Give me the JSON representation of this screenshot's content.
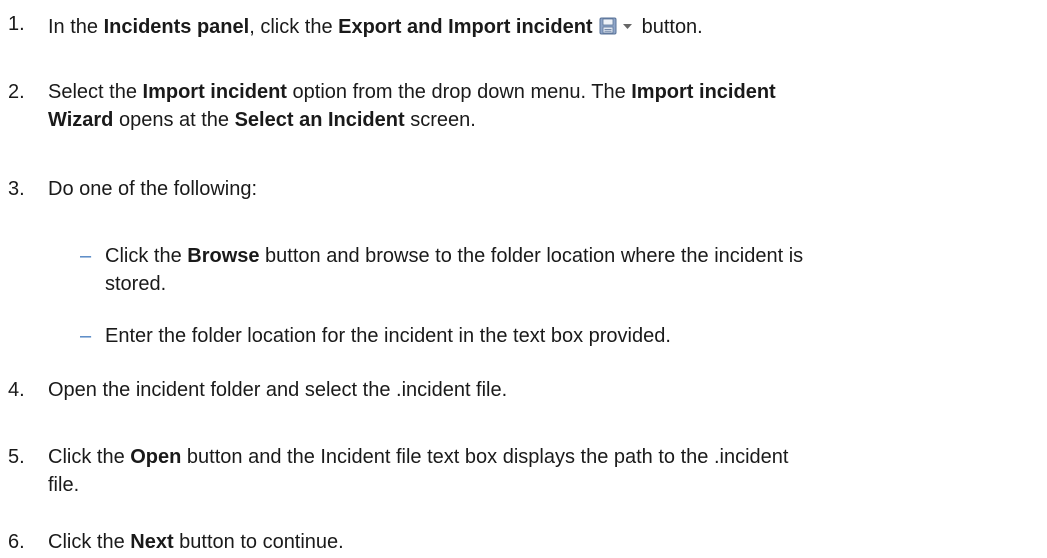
{
  "steps": [
    {
      "num": "1.",
      "p1": "In the ",
      "b1": "Incidents panel",
      "p2": ", click the ",
      "b2": "Export and Import incident",
      "icon": "save-icon",
      "p3": "button."
    },
    {
      "num": "2.",
      "p1": "Select the ",
      "b1": "Import incident",
      "p2": " option from the drop down menu. The ",
      "b2": "Import incident",
      "b3": "Wizard",
      "p3": " opens at the ",
      "b4": "Select an Incident",
      "p4": " screen."
    },
    {
      "num": "3.",
      "text": "Do one of the following:"
    },
    {
      "num": "4.",
      "text": "Open the incident folder and select the .incident file."
    },
    {
      "num": "5.",
      "p1": "Click the ",
      "b1": "Open",
      "p2": " button and the Incident file text box displays the path to the .incident",
      "p3": "file."
    },
    {
      "num": "6.",
      "p1": "Click the ",
      "b1": "Next",
      "p2": " button to continue."
    }
  ],
  "substeps": [
    {
      "dash": "–",
      "p1": "Click the ",
      "b1": "Browse",
      "p2": " button and browse to the folder location where the incident is",
      "p3": "stored."
    },
    {
      "dash": "–",
      "text": "Enter the folder location for the incident in the text box provided."
    }
  ],
  "colors": {
    "dash": "#4a7fc1",
    "text": "#1a1a1a",
    "icon_fill": "#8fa6c9"
  }
}
